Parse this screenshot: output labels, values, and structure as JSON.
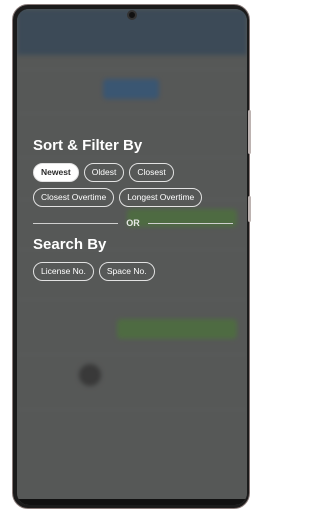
{
  "colors": {
    "overlay": "#464646",
    "chip_border": "#e2e2e2",
    "chip_active_bg": "#ffffff",
    "bg_header": "#31506d",
    "bg_green": "#5a9a3e"
  },
  "sort_filter": {
    "title": "Sort & Filter By",
    "options": [
      {
        "label": "Newest",
        "selected": true
      },
      {
        "label": "Oldest",
        "selected": false
      },
      {
        "label": "Closest",
        "selected": false
      },
      {
        "label": "Closest Overtime",
        "selected": false
      },
      {
        "label": "Longest Overtime",
        "selected": false
      }
    ]
  },
  "divider": {
    "label": "OR"
  },
  "search_by": {
    "title": "Search By",
    "options": [
      {
        "label": "License No."
      },
      {
        "label": "Space No."
      }
    ]
  }
}
